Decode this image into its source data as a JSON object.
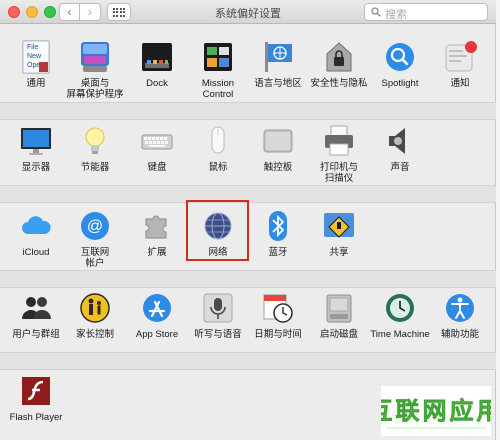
{
  "window": {
    "title": "系统偏好设置"
  },
  "toolbar": {
    "back_glyph": "‹",
    "forward_glyph": "›"
  },
  "search": {
    "placeholder": "搜索"
  },
  "rows": [
    [
      {
        "label": "通用",
        "icon": "general-icon"
      },
      {
        "label": "桌面与\n屏幕保护程序",
        "icon": "desktop-screensaver-icon"
      },
      {
        "label": "Dock",
        "icon": "dock-icon"
      },
      {
        "label": "Mission\nControl",
        "icon": "mission-control-icon"
      },
      {
        "label": "语言与地区",
        "icon": "language-region-icon"
      },
      {
        "label": "安全性与隐私",
        "icon": "security-privacy-icon"
      },
      {
        "label": "Spotlight",
        "icon": "spotlight-icon"
      },
      {
        "label": "通知",
        "icon": "notifications-icon"
      }
    ],
    [
      {
        "label": "显示器",
        "icon": "displays-icon"
      },
      {
        "label": "节能器",
        "icon": "energy-saver-icon"
      },
      {
        "label": "键盘",
        "icon": "keyboard-icon"
      },
      {
        "label": "鼠标",
        "icon": "mouse-icon"
      },
      {
        "label": "触控板",
        "icon": "trackpad-icon"
      },
      {
        "label": "打印机与\n扫描仪",
        "icon": "printers-scanners-icon"
      },
      {
        "label": "声音",
        "icon": "sound-icon"
      }
    ],
    [
      {
        "label": "iCloud",
        "icon": "icloud-icon"
      },
      {
        "label": "互联网\n帐户",
        "icon": "internet-accounts-icon"
      },
      {
        "label": "扩展",
        "icon": "extensions-icon"
      },
      {
        "label": "网络",
        "icon": "network-icon"
      },
      {
        "label": "蓝牙",
        "icon": "bluetooth-icon"
      },
      {
        "label": "共享",
        "icon": "sharing-icon"
      }
    ],
    [
      {
        "label": "用户与群组",
        "icon": "users-groups-icon"
      },
      {
        "label": "家长控制",
        "icon": "parental-controls-icon"
      },
      {
        "label": "App Store",
        "icon": "app-store-icon"
      },
      {
        "label": "听写与语音",
        "icon": "dictation-speech-icon"
      },
      {
        "label": "日期与时间",
        "icon": "date-time-icon"
      },
      {
        "label": "启动磁盘",
        "icon": "startup-disk-icon"
      },
      {
        "label": "Time Machine",
        "icon": "time-machine-icon"
      },
      {
        "label": "辅助功能",
        "icon": "accessibility-icon"
      }
    ],
    [
      {
        "label": "Flash Player",
        "icon": "flash-player-icon"
      }
    ]
  ],
  "general_icon_text": [
    "File",
    "New",
    "Ope"
  ],
  "watermark": {
    "title": "互联网应用",
    "icon": "watermark-logo-icon"
  },
  "colors": {
    "highlight": "#d42c1b",
    "accent": "#2f8ae5"
  }
}
